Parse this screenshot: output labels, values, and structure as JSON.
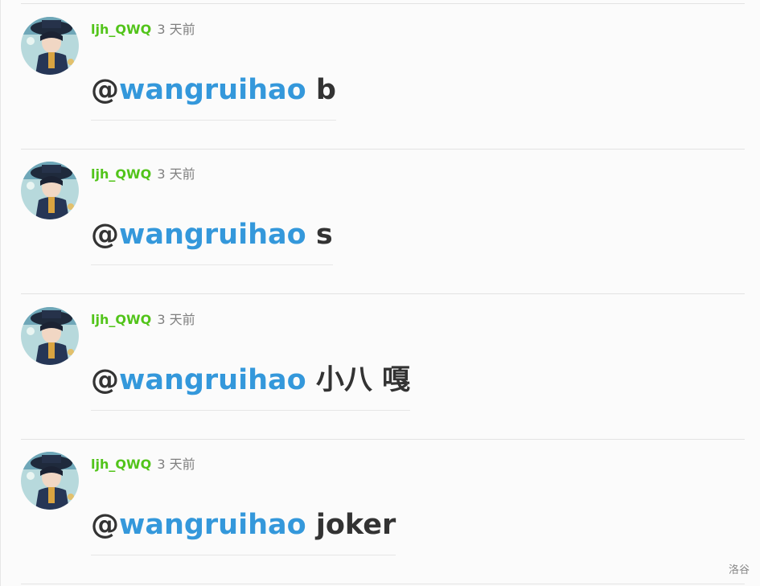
{
  "comments": [
    {
      "username": "ljh_QWQ",
      "time": "3 天前",
      "at": "@",
      "mention": "wangruihao",
      "text": " b"
    },
    {
      "username": "ljh_QWQ",
      "time": "3 天前",
      "at": "@",
      "mention": "wangruihao",
      "text": " s"
    },
    {
      "username": "ljh_QWQ",
      "time": "3 天前",
      "at": "@",
      "mention": "wangruihao",
      "text": " 小八 嘎"
    },
    {
      "username": "ljh_QWQ",
      "time": "3 天前",
      "at": "@",
      "mention": "wangruihao",
      "text": " joker"
    }
  ],
  "footer": {
    "brand": "洛谷"
  },
  "colors": {
    "username": "#52c41a",
    "mention": "#3498db",
    "text": "#333333",
    "time": "#7f7f7f"
  }
}
